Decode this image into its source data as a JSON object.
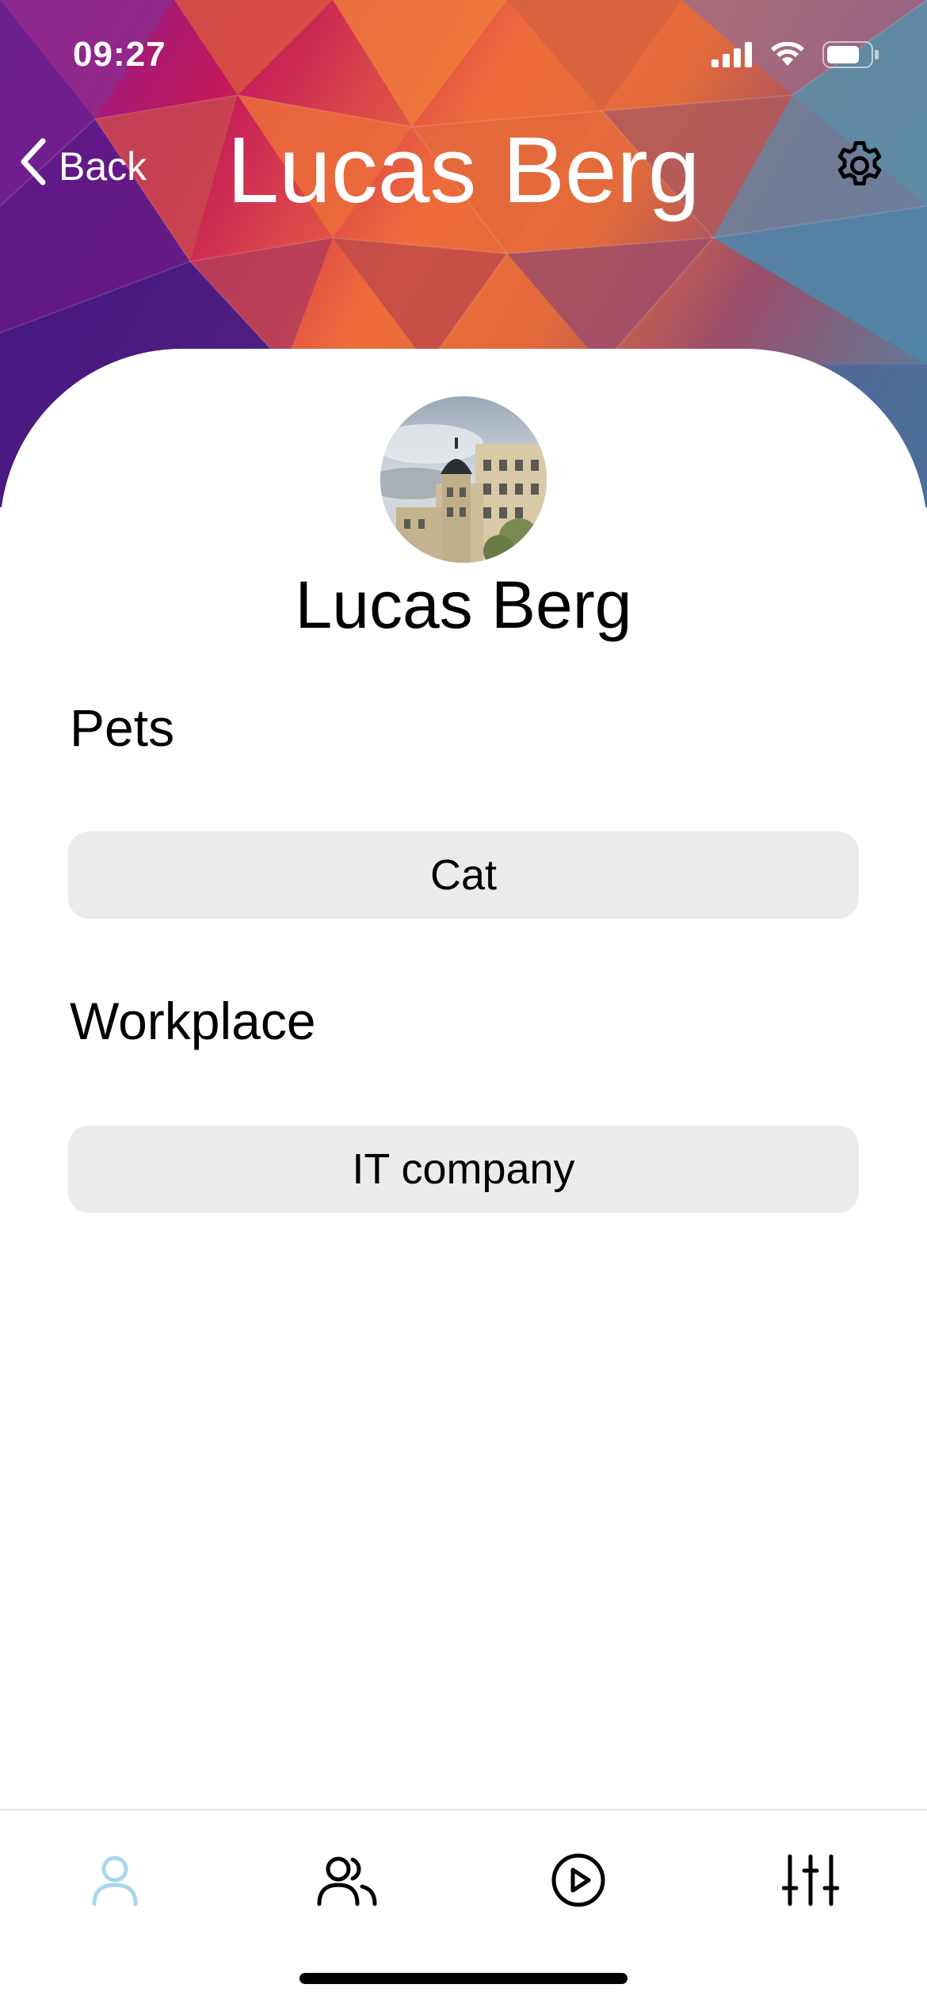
{
  "status_bar": {
    "time": "09:27",
    "icons": [
      "cellular-signal-icon",
      "wifi-icon",
      "battery-icon"
    ]
  },
  "nav": {
    "back_label": "Back",
    "title": "Lucas Berg",
    "settings_icon": "gear-icon"
  },
  "profile": {
    "name": "Lucas Berg",
    "avatar": "building-photo"
  },
  "fields": [
    {
      "label": "Pets",
      "value": "Cat"
    },
    {
      "label": "Workplace",
      "value": "IT company"
    }
  ],
  "tab_bar": {
    "tabs": [
      {
        "icon": "person-icon",
        "active": true
      },
      {
        "icon": "people-icon",
        "active": false
      },
      {
        "icon": "play-circle-icon",
        "active": false
      },
      {
        "icon": "sliders-icon",
        "active": false
      }
    ],
    "active_color": "#a9d7ea",
    "inactive_color": "#000000"
  }
}
